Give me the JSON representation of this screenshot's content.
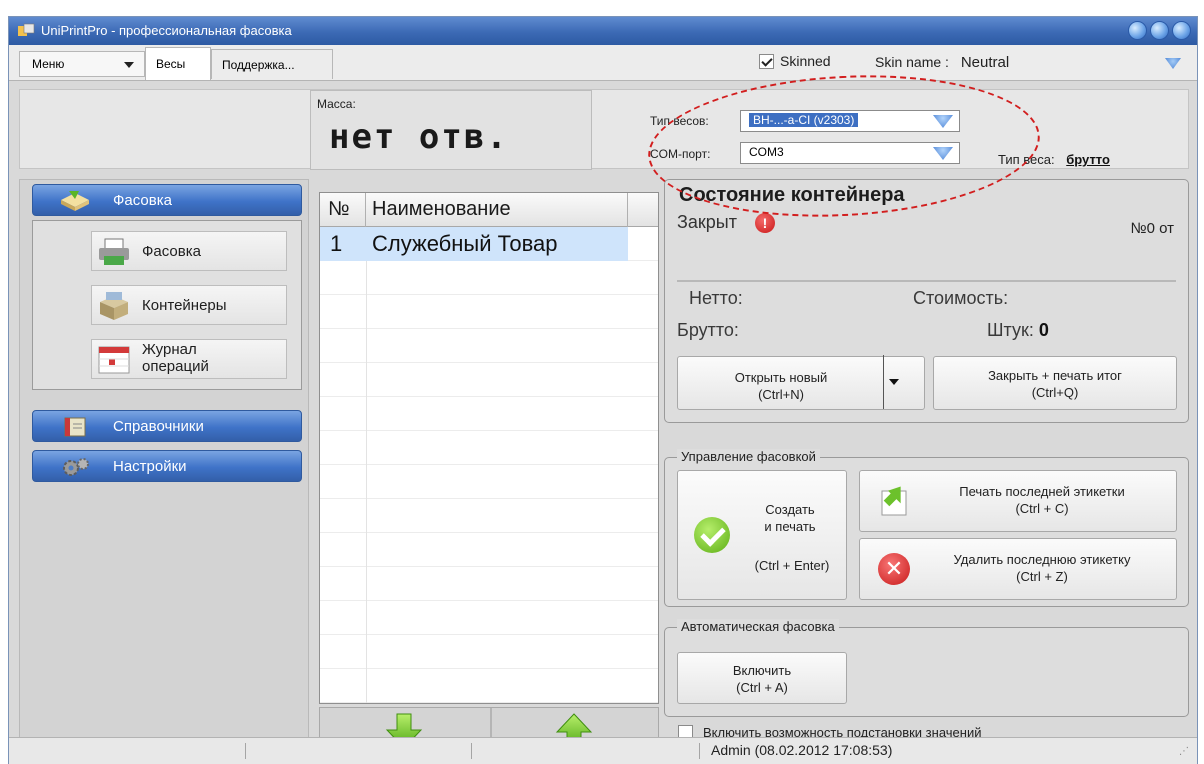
{
  "window": {
    "title": "UniPrintPro - профессиональная фасовка"
  },
  "tabs": {
    "menu_label": "Меню",
    "items": [
      {
        "label": "Весы",
        "active": true
      },
      {
        "label": "Поддержка...",
        "active": false
      }
    ]
  },
  "skin": {
    "skinned_label": "Skinned",
    "skinned_checked": true,
    "name_label": "Skin name :",
    "name_value": "Neutral"
  },
  "scale": {
    "mass_label": "Масса:",
    "mass_value": "нет отв.",
    "scale_type_label": "Тип весов:",
    "scale_type_value": "ВН-...-а-СІ (v2303)",
    "com_label": "COM-порт:",
    "com_value": "COM3",
    "weight_type_label": "Тип веса:",
    "weight_type_value": "брутто"
  },
  "nav": {
    "sections": [
      {
        "label": "Фасовка",
        "icon": "package-icon"
      },
      {
        "label": "Справочники",
        "icon": "book-icon"
      },
      {
        "label": "Настройки",
        "icon": "gears-icon"
      }
    ],
    "items": [
      {
        "label": "Фасовка",
        "icon": "printer-icon"
      },
      {
        "label": "Контейнеры",
        "icon": "box-icon"
      },
      {
        "label_line1": "Журнал",
        "label_line2": "операций",
        "icon": "calendar-icon"
      }
    ]
  },
  "products": {
    "columns": [
      "№",
      "Наименование"
    ],
    "rows": [
      {
        "n": "1",
        "name": "Служебный Товар",
        "selected": true
      }
    ]
  },
  "container": {
    "title": "Состояние контейнера",
    "status": "Закрыт",
    "number": "№0 от",
    "net_label": "Нетто:",
    "cost_label": "Стоимость:",
    "gross_label": "Брутто:",
    "pieces_label": "Штук:",
    "pieces_value": "0",
    "open_new_line1": "Открыть новый",
    "open_new_line2": "(Ctrl+N)",
    "close_print_line1": "Закрыть + печать итог",
    "close_print_line2": "(Ctrl+Q)"
  },
  "packing": {
    "title": "Управление фасовкой",
    "create_line1": "Создать",
    "create_line2": "и печать",
    "create_line3": "(Ctrl + Enter)",
    "print_last_line1": "Печать последней этикетки",
    "print_last_line2": "(Ctrl + C)",
    "delete_last_line1": "Удалить последнюю этикетку",
    "delete_last_line2": "(Ctrl + Z)"
  },
  "auto": {
    "title": "Автоматическая фасовка",
    "enable_line1": "Включить",
    "enable_line2": "(Ctrl + A)"
  },
  "substitution": {
    "label": "Включить возможность подстановки значений",
    "checked": false
  },
  "status": {
    "user": "Admin (08.02.2012 17:08:53)"
  },
  "colors": {
    "accent": "#3f73c8",
    "alert": "#c91616",
    "ok": "#5dae15",
    "annotation": "#d21e1e"
  }
}
